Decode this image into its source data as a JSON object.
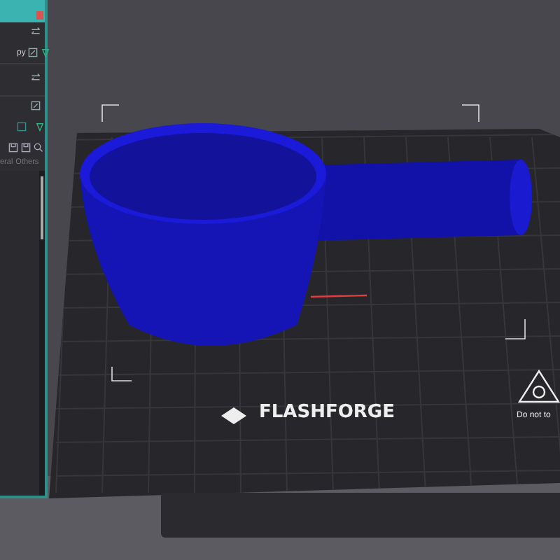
{
  "panel": {
    "name_field": "py",
    "tabs": [
      {
        "label": "eral",
        "selected": false
      },
      {
        "label": "Others",
        "selected": false
      }
    ]
  },
  "plate": {
    "brand": "FLASHFORGE",
    "warning": "Do not to"
  }
}
